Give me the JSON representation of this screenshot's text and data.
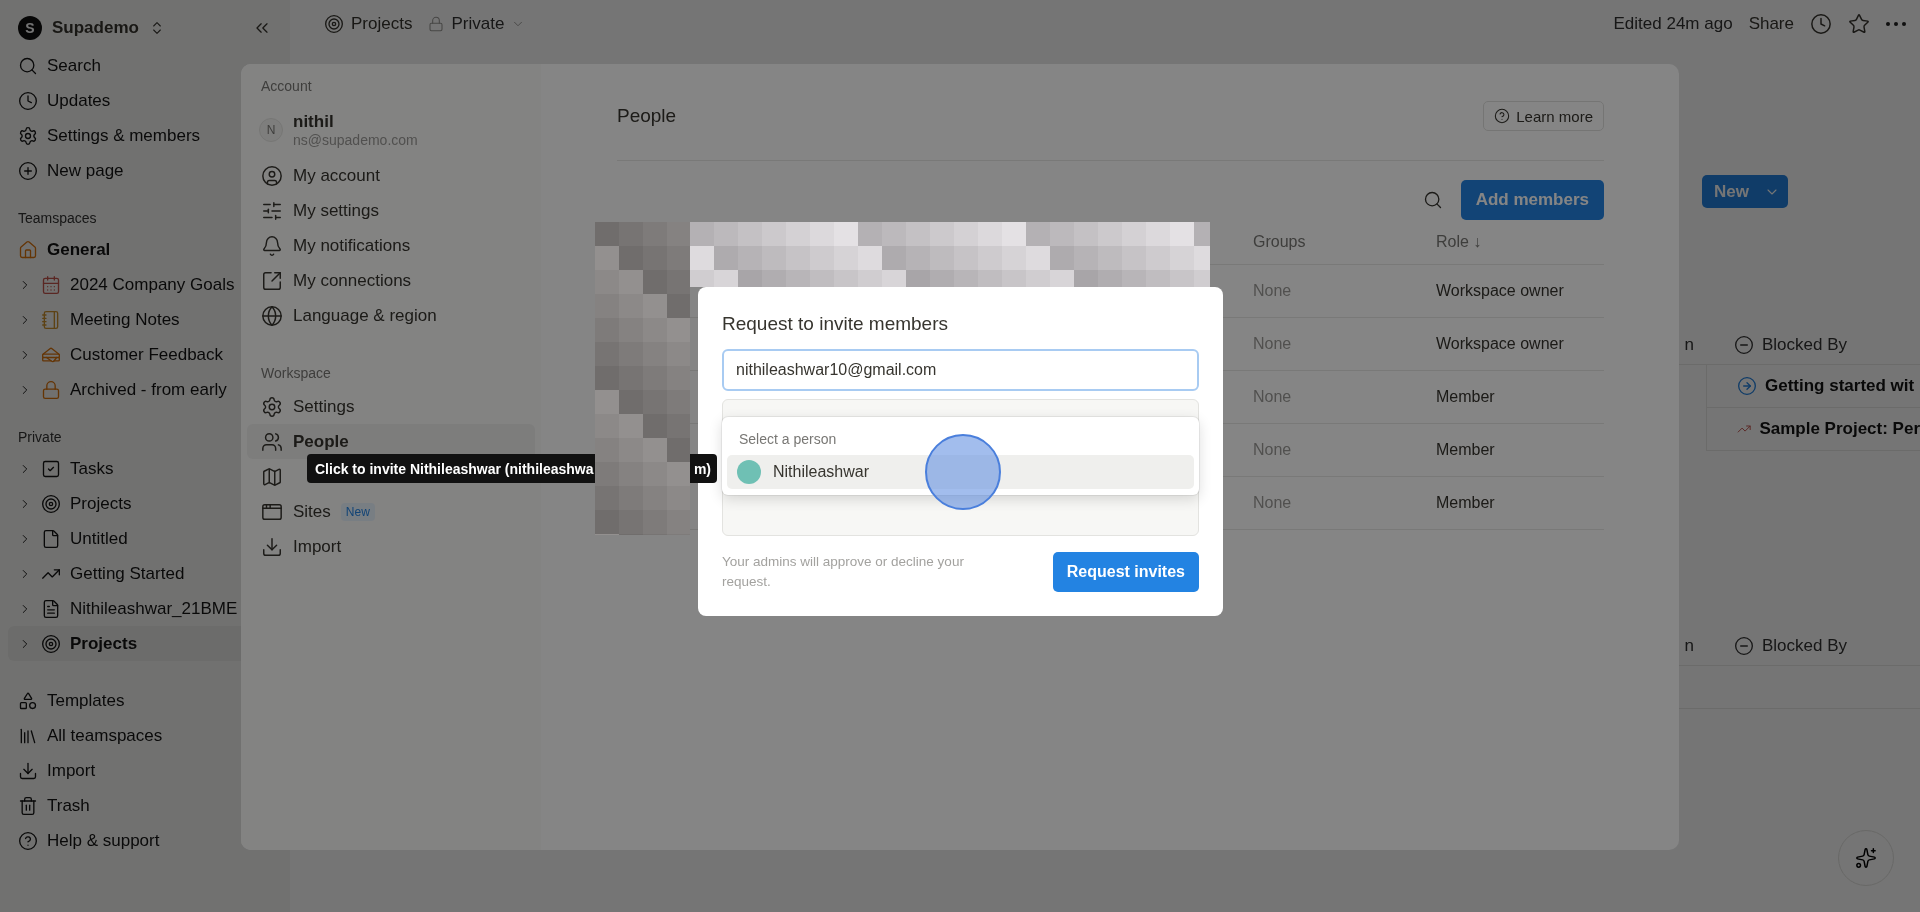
{
  "sidebar": {
    "workspace": {
      "initial": "S",
      "name": "Supademo"
    },
    "nav": [
      "Search",
      "Updates",
      "Settings & members",
      "New page"
    ],
    "teamspaces": {
      "label": "Teamspaces",
      "items": [
        {
          "label": "General",
          "kind": "plain"
        },
        {
          "label": "2024 Company Goals",
          "kind": "toggle"
        },
        {
          "label": "Meeting Notes",
          "kind": "toggle"
        },
        {
          "label": "Customer Feedback",
          "kind": "toggle"
        },
        {
          "label": "Archived - from early",
          "kind": "toggle"
        }
      ]
    },
    "private": {
      "label": "Private",
      "items": [
        {
          "label": "Tasks",
          "selected": false
        },
        {
          "label": "Projects",
          "selected": false
        },
        {
          "label": "Untitled",
          "selected": false
        },
        {
          "label": "Getting Started",
          "selected": false
        },
        {
          "label": "Nithileashwar_21BME",
          "selected": false
        },
        {
          "label": "Projects",
          "selected": true
        }
      ]
    },
    "bottom": [
      "Templates",
      "All teamspaces",
      "Import",
      "Trash",
      "Help & support"
    ]
  },
  "topbar": {
    "breadcrumb": "Projects",
    "visibility": "Private",
    "edited": "Edited 24m ago",
    "share": "Share"
  },
  "page": {
    "new_button": "New",
    "tables": [
      {
        "column_1": "n",
        "column_2": "Blocked By",
        "rows": [
          "Getting started wit",
          "Sample Project: Per"
        ]
      },
      {
        "column_1": "n",
        "column_2": "Blocked By"
      }
    ]
  },
  "settings": {
    "account": {
      "label": "Account",
      "user": {
        "initial": "N",
        "name": "nithil",
        "email": "ns@supademo.com"
      },
      "items": [
        {
          "label": "My account",
          "selected": false
        },
        {
          "label": "My settings",
          "selected": false
        },
        {
          "label": "My notifications",
          "selected": false
        },
        {
          "label": "My connections",
          "selected": false
        },
        {
          "label": "Language & region",
          "selected": false
        }
      ]
    },
    "workspace": {
      "label": "Workspace",
      "items": [
        {
          "label": "Settings",
          "selected": false
        },
        {
          "label": "People",
          "selected": true
        },
        {
          "label": "Sites",
          "selected": false,
          "badge": "New"
        },
        {
          "label": "Import",
          "selected": false
        }
      ]
    },
    "title": "People",
    "learn_more": "Learn more",
    "add_members": "Add members",
    "table": {
      "columns": [
        "Groups",
        "Role ↓"
      ],
      "rows": [
        {
          "groups": "None",
          "role": "Workspace owner"
        },
        {
          "groups": "None",
          "role": "Workspace owner"
        },
        {
          "groups": "None",
          "role": "Member"
        },
        {
          "groups": "None",
          "role": "Member"
        },
        {
          "groups": "None",
          "role": "Member"
        }
      ]
    }
  },
  "tooltip": {
    "text": "Click to invite Nithileashwar (nithileashwa",
    "tail": "m)"
  },
  "dialog": {
    "title": "Request to invite members",
    "email": "nithileashwar10@gmail.com",
    "suggestions": {
      "label": "Select a person",
      "people": [
        {
          "name": "Nithileashwar",
          "color": "#6fc0b4",
          "selected": true
        }
      ]
    },
    "note": "Your admins will approve or decline your request.",
    "submit": "Request invites"
  }
}
